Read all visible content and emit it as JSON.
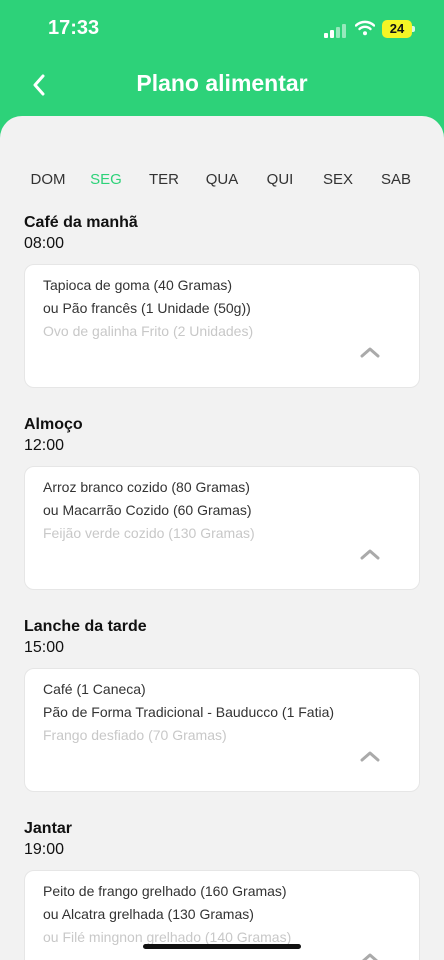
{
  "status_bar": {
    "time": "17:33",
    "battery": "24"
  },
  "header": {
    "title": "Plano alimentar"
  },
  "days": [
    {
      "label": "DOM",
      "active": false
    },
    {
      "label": "SEG",
      "active": true
    },
    {
      "label": "TER",
      "active": false
    },
    {
      "label": "QUA",
      "active": false
    },
    {
      "label": "QUI",
      "active": false
    },
    {
      "label": "SEX",
      "active": false
    },
    {
      "label": "SAB",
      "active": false
    }
  ],
  "meals": [
    {
      "name": "Café da manhã",
      "time": "08:00",
      "items": [
        "Tapioca de goma  (40 Gramas)",
        "ou Pão francês (1 Unidade (50g))",
        "Ovo de galinha Frito (2 Unidades)"
      ]
    },
    {
      "name": "Almoço",
      "time": "12:00",
      "items": [
        "Arroz branco cozido (80 Gramas)",
        "ou Macarrão  Cozido (60 Gramas)",
        "Feijão verde cozido (130 Gramas)"
      ]
    },
    {
      "name": "Lanche da tarde",
      "time": "15:00",
      "items": [
        "Café   (1 Caneca)",
        "Pão de Forma Tradicional - Bauducco (1 Fatia)",
        "Frango desfiado (70 Gramas)"
      ]
    },
    {
      "name": "Jantar",
      "time": "19:00",
      "items": [
        "Peito de frango grelhado (160 Gramas)",
        "ou Alcatra grelhada (130 Gramas)",
        "ou Filé mingnon grelhado (140 Gramas)"
      ]
    }
  ],
  "colors": {
    "accent": "#2dd279",
    "background": "#f2f2f2",
    "faded_text": "#c8c8c8"
  },
  "icons": {
    "back": "chevron-left-icon",
    "collapse": "chevron-up-icon"
  }
}
